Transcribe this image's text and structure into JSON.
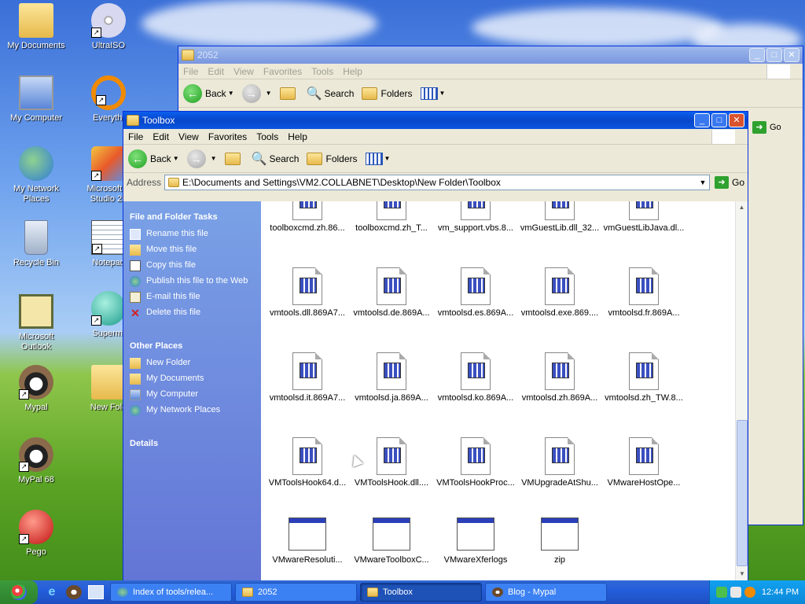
{
  "desktop": {
    "icons": [
      {
        "label": "My Documents",
        "icon": "my-documents-icon"
      },
      {
        "label": "UltraISO",
        "icon": "ultraiso-icon"
      },
      {
        "label": "My Computer",
        "icon": "my-computer-icon"
      },
      {
        "label": "Everythi",
        "icon": "everything-icon"
      },
      {
        "label": "My Network Places",
        "icon": "network-places-icon"
      },
      {
        "label": "Microsoft V Studio 20",
        "icon": "visual-studio-icon"
      },
      {
        "label": "Recycle Bin",
        "icon": "recycle-bin-icon"
      },
      {
        "label": "Notepad",
        "icon": "notepad-icon"
      },
      {
        "label": "Microsoft Outlook",
        "icon": "outlook-icon"
      },
      {
        "label": "Supermi",
        "icon": "supermium-icon"
      },
      {
        "label": "Mypal",
        "icon": "mypal-icon"
      },
      {
        "label": "New Fold",
        "icon": "folder-icon"
      },
      {
        "label": "MyPal 68",
        "icon": "mypal-icon"
      },
      {
        "label": "Pego",
        "icon": "pego-icon"
      }
    ]
  },
  "back_window": {
    "title": "2052",
    "menu": [
      "File",
      "Edit",
      "View",
      "Favorites",
      "Tools",
      "Help"
    ],
    "toolbar": {
      "back": "Back",
      "search": "Search",
      "folders": "Folders"
    },
    "go": "Go"
  },
  "front_window": {
    "title": "Toolbox",
    "menu": [
      "File",
      "Edit",
      "View",
      "Favorites",
      "Tools",
      "Help"
    ],
    "toolbar": {
      "back": "Back",
      "search": "Search",
      "folders": "Folders"
    },
    "address_label": "Address",
    "address_value": "E:\\Documents and Settings\\VM2.COLLABNET\\Desktop\\New Folder\\Toolbox",
    "go": "Go",
    "tasks_header": "File and Folder Tasks",
    "tasks": [
      {
        "label": "Rename this file",
        "icon": "rename-icon"
      },
      {
        "label": "Move this file",
        "icon": "move-icon"
      },
      {
        "label": "Copy this file",
        "icon": "copy-icon"
      },
      {
        "label": "Publish this file to the Web",
        "icon": "publish-web-icon"
      },
      {
        "label": "E-mail this file",
        "icon": "email-icon"
      },
      {
        "label": "Delete this file",
        "icon": "delete-icon"
      }
    ],
    "places_header": "Other Places",
    "places": [
      {
        "label": "New Folder",
        "icon": "folder-icon"
      },
      {
        "label": "My Documents",
        "icon": "my-documents-icon"
      },
      {
        "label": "My Computer",
        "icon": "my-computer-icon"
      },
      {
        "label": "My Network Places",
        "icon": "network-places-icon"
      }
    ],
    "details_header": "Details",
    "files": [
      "toolboxcmd.zh.86...",
      "toolboxcmd.zh_T...",
      "vm_support.vbs.8...",
      "vmGuestLib.dll_32...",
      "vmGuestLibJava.dl...",
      "vmtools.dll.869A7...",
      "vmtoolsd.de.869A...",
      "vmtoolsd.es.869A...",
      "vmtoolsd.exe.869....",
      "vmtoolsd.fr.869A...",
      "vmtoolsd.it.869A7...",
      "vmtoolsd.ja.869A...",
      "vmtoolsd.ko.869A...",
      "vmtoolsd.zh.869A...",
      "vmtoolsd.zh_TW.8...",
      "VMToolsHook64.d...",
      "VMToolsHook.dll....",
      "VMToolsHookProc...",
      "VMUpgradeAtShu...",
      "VMwareHostOpe...",
      "VMwareResoluti...",
      "VMwareToolboxC...",
      "VMwareXferlogs",
      "zip"
    ]
  },
  "taskbar": {
    "tasks": [
      {
        "label": "Index of tools/relea...",
        "icon": "browser-icon"
      },
      {
        "label": "2052",
        "icon": "folder-icon"
      },
      {
        "label": "Toolbox",
        "icon": "folder-icon"
      },
      {
        "label": "Blog - Mypal",
        "icon": "mypal-icon"
      }
    ],
    "clock": "12:44 PM"
  }
}
